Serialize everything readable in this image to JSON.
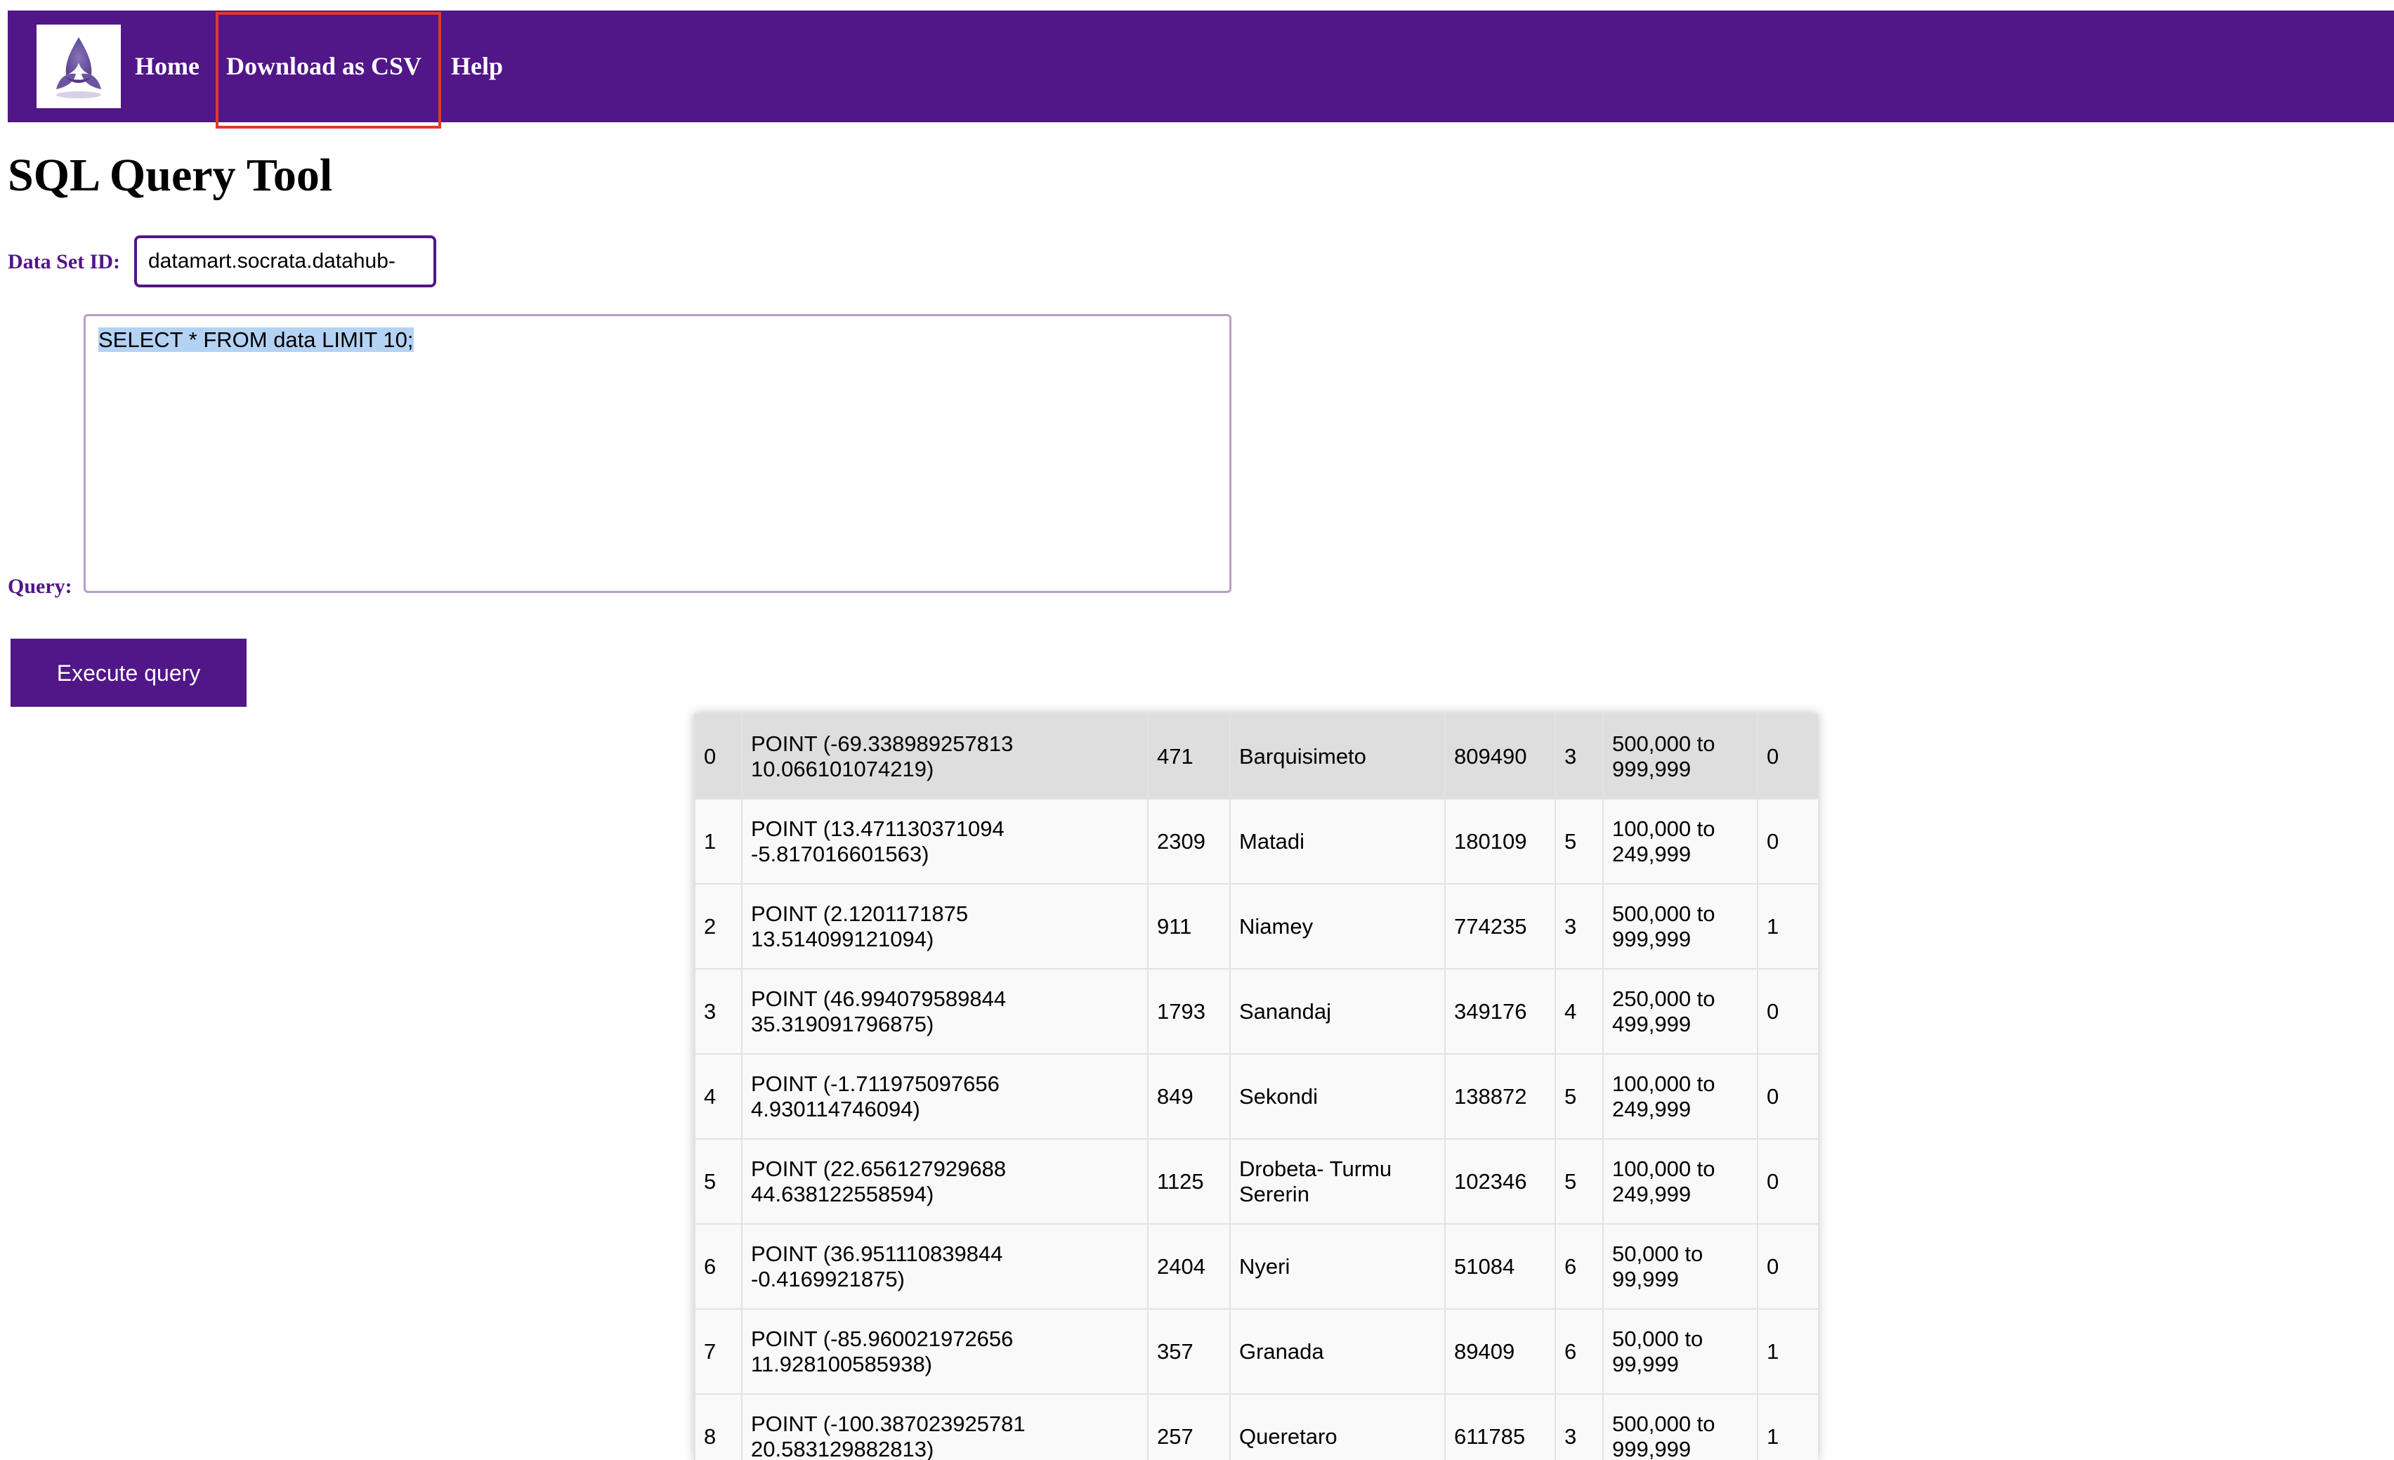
{
  "nav": {
    "home": "Home",
    "download_csv": "Download as CSV",
    "help": "Help"
  },
  "page_title": "SQL Query Tool",
  "dataset": {
    "label": "Data Set ID:",
    "value": "datamart.socrata.datahub-"
  },
  "query": {
    "label": "Query:",
    "value": "SELECT * FROM data LIMIT 10;"
  },
  "execute_label": "Execute query",
  "colors": {
    "brand": "#511687",
    "highlight": "#e0392b",
    "selection": "#b4d3f4"
  },
  "icons": {
    "logo": "trefoil-logo-icon"
  },
  "results": {
    "rows": [
      {
        "idx": "0",
        "point_line1": "POINT (-69.338989257813",
        "point_line2": "10.066101074219)",
        "id": "471",
        "city": "Barquisimeto",
        "pop": "809490",
        "cls": "3",
        "range_line1": "500,000 to",
        "range_line2": "999,999",
        "flag": "0"
      },
      {
        "idx": "1",
        "point_line1": "POINT (13.471130371094",
        "point_line2": "-5.817016601563)",
        "id": "2309",
        "city": "Matadi",
        "pop": "180109",
        "cls": "5",
        "range_line1": "100,000 to",
        "range_line2": "249,999",
        "flag": "0"
      },
      {
        "idx": "2",
        "point_line1": "POINT (2.1201171875",
        "point_line2": "13.514099121094)",
        "id": "911",
        "city": "Niamey",
        "pop": "774235",
        "cls": "3",
        "range_line1": "500,000 to",
        "range_line2": "999,999",
        "flag": "1"
      },
      {
        "idx": "3",
        "point_line1": "POINT (46.994079589844",
        "point_line2": "35.319091796875)",
        "id": "1793",
        "city": "Sanandaj",
        "pop": "349176",
        "cls": "4",
        "range_line1": "250,000 to",
        "range_line2": "499,999",
        "flag": "0"
      },
      {
        "idx": "4",
        "point_line1": "POINT (-1.711975097656",
        "point_line2": "4.930114746094)",
        "id": "849",
        "city": "Sekondi",
        "pop": "138872",
        "cls": "5",
        "range_line1": "100,000 to",
        "range_line2": "249,999",
        "flag": "0"
      },
      {
        "idx": "5",
        "point_line1": "POINT (22.656127929688",
        "point_line2": "44.638122558594)",
        "id": "1125",
        "city": "Drobeta- Turmu Sererin",
        "pop": "102346",
        "cls": "5",
        "range_line1": "100,000 to",
        "range_line2": "249,999",
        "flag": "0"
      },
      {
        "idx": "6",
        "point_line1": "POINT (36.951110839844",
        "point_line2": "-0.4169921875)",
        "id": "2404",
        "city": "Nyeri",
        "pop": "51084",
        "cls": "6",
        "range_line1": "50,000 to",
        "range_line2": "99,999",
        "flag": "0"
      },
      {
        "idx": "7",
        "point_line1": "POINT (-85.960021972656",
        "point_line2": "11.928100585938)",
        "id": "357",
        "city": "Granada",
        "pop": "89409",
        "cls": "6",
        "range_line1": "50,000 to",
        "range_line2": "99,999",
        "flag": "1"
      },
      {
        "idx": "8",
        "point_line1": "POINT (-100.387023925781",
        "point_line2": "20.583129882813)",
        "id": "257",
        "city": "Queretaro",
        "pop": "611785",
        "cls": "3",
        "range_line1": "500,000 to",
        "range_line2": "999,999",
        "flag": "1"
      }
    ]
  }
}
